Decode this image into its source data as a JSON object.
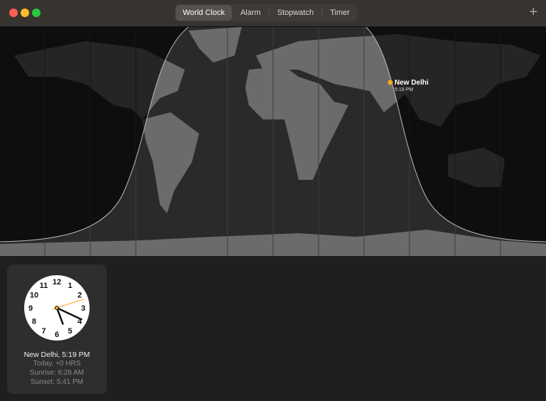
{
  "window": {
    "controls": [
      "close",
      "minimize",
      "zoom"
    ],
    "colors": {
      "close": "#fe5f57",
      "minimize": "#febc2e",
      "zoom": "#28c840"
    }
  },
  "tabs": [
    {
      "label": "World Clock",
      "active": true
    },
    {
      "label": "Alarm"
    },
    {
      "label": "Stopwatch"
    },
    {
      "label": "Timer"
    }
  ],
  "toolbar": {
    "add_icon": "plus-icon"
  },
  "map": {
    "pin": {
      "city": "New Delhi",
      "time": "5:19 PM",
      "color": "#f5a623"
    }
  },
  "clock_card": {
    "hours": [
      "12",
      "1",
      "2",
      "3",
      "4",
      "5",
      "6",
      "7",
      "8",
      "9",
      "10",
      "11"
    ],
    "time": {
      "hour": 5,
      "minute": 19,
      "second": 12
    },
    "title": "New Delhi, 5:19 PM",
    "offset": "Today, +0 HRS",
    "sunrise": "Sunrise: 6:28 AM",
    "sunset": "Sunset: 5:41 PM",
    "second_hand_color": "#f5a623"
  }
}
